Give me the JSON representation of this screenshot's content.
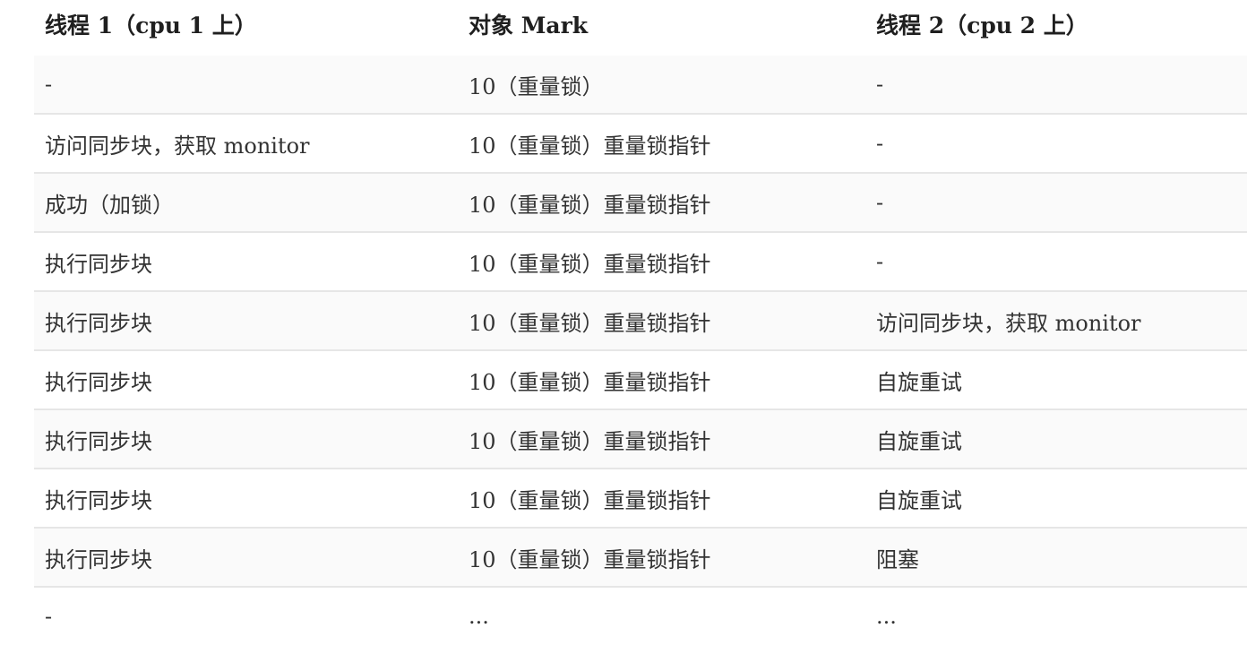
{
  "table": {
    "headers": [
      "线程 1（cpu 1 上）",
      "对象 Mark",
      "线程 2（cpu 2 上）"
    ],
    "rows": [
      [
        "-",
        "10（重量锁）",
        "-"
      ],
      [
        "访问同步块，获取 monitor",
        "10（重量锁）重量锁指针",
        "-"
      ],
      [
        "成功（加锁）",
        "10（重量锁）重量锁指针",
        "-"
      ],
      [
        "执行同步块",
        "10（重量锁）重量锁指针",
        "-"
      ],
      [
        "执行同步块",
        "10（重量锁）重量锁指针",
        "访问同步块，获取 monitor"
      ],
      [
        "执行同步块",
        "10（重量锁）重量锁指针",
        "自旋重试"
      ],
      [
        "执行同步块",
        "10（重量锁）重量锁指针",
        "自旋重试"
      ],
      [
        "执行同步块",
        "10（重量锁）重量锁指针",
        "自旋重试"
      ],
      [
        "执行同步块",
        "10（重量锁）重量锁指针",
        "阻塞"
      ],
      [
        "-",
        "...",
        "..."
      ]
    ]
  }
}
